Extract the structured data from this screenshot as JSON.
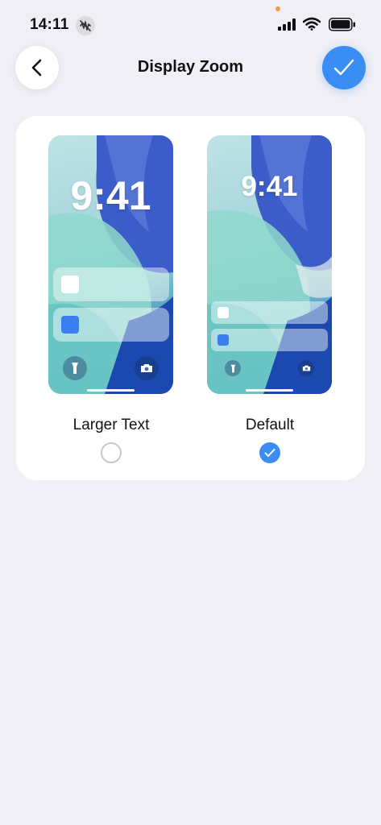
{
  "status_bar": {
    "time": "14:11",
    "icons": [
      "mute-icon",
      "signal-icon",
      "wifi-icon",
      "battery-icon"
    ]
  },
  "header": {
    "title": "Display Zoom",
    "back_icon": "chevron-left-icon",
    "done_icon": "checkmark-icon"
  },
  "options": [
    {
      "label": "Larger Text",
      "preview_time": "9:41",
      "selected": false
    },
    {
      "label": "Default",
      "preview_time": "9:41",
      "selected": true
    }
  ],
  "colors": {
    "accent": "#3a8df4",
    "background": "#f0eff5",
    "card": "#ffffff"
  }
}
